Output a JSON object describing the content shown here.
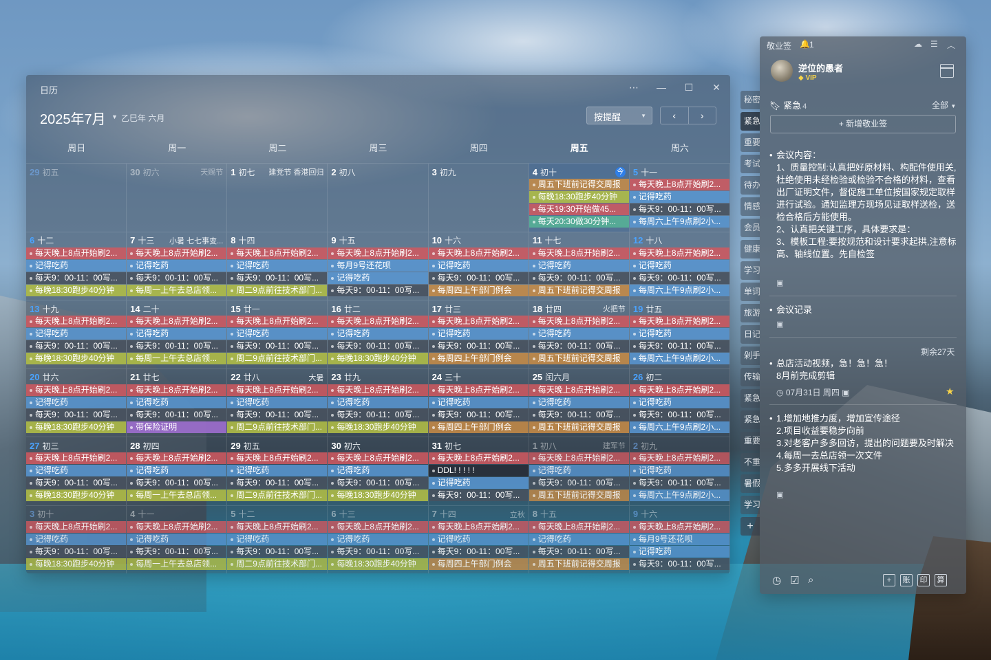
{
  "calendar": {
    "window_title": "日历",
    "controls": {
      "more": "⋯",
      "minimize": "—",
      "maximize": "☐",
      "close": "✕"
    },
    "month_title": "2025年7月",
    "lunar_year": "乙巳年 六月",
    "view_mode": "按提醒",
    "nav_prev": "‹",
    "nav_next": "›",
    "weekdays": [
      "周日",
      "周一",
      "周二",
      "周三",
      "周四",
      "周五",
      "周六"
    ],
    "today_badge": "今",
    "weeks": [
      [
        {
          "d": "29",
          "l": "初五",
          "f": "",
          "faded": true,
          "wk": true,
          "ev": []
        },
        {
          "d": "30",
          "l": "初六",
          "f": "天赐节",
          "faded": true,
          "ev": []
        },
        {
          "d": "1",
          "l": "初七",
          "f": "建党节 香港回归",
          "ev": []
        },
        {
          "d": "2",
          "l": "初八",
          "f": "",
          "ev": []
        },
        {
          "d": "3",
          "l": "初九",
          "f": "",
          "ev": []
        },
        {
          "d": "4",
          "l": "初十",
          "f": "",
          "today": true,
          "ev": [
            {
              "t": "周五下班前记得交周报",
              "c": "orange"
            },
            {
              "t": "每晚18:30跑步40分钟",
              "c": "yellow"
            },
            {
              "t": "每天19:30开始做45...",
              "c": "red"
            },
            {
              "t": "每天20:30做30分钟...",
              "c": "teal"
            }
          ]
        },
        {
          "d": "5",
          "l": "十一",
          "f": "",
          "wk": true,
          "ev": [
            {
              "t": "每天晚上8点开始刷2...",
              "c": "red"
            },
            {
              "t": "记得吃药",
              "c": "blue"
            },
            {
              "t": "每天9：00-11：00写...",
              "c": "gray"
            },
            {
              "t": "每周六上午9点刷2小...",
              "c": "blue"
            }
          ]
        }
      ],
      [
        {
          "d": "6",
          "l": "十二",
          "f": "",
          "wk": true,
          "ev": [
            {
              "t": "每天晚上8点开始刷2...",
              "c": "red"
            },
            {
              "t": "记得吃药",
              "c": "blue"
            },
            {
              "t": "每天9：00-11：00写...",
              "c": "gray"
            },
            {
              "t": "每晚18:30跑步40分钟",
              "c": "yellow"
            }
          ]
        },
        {
          "d": "7",
          "l": "十三",
          "f": "小暑 七七事变...",
          "ev": [
            {
              "t": "每天晚上8点开始刷2...",
              "c": "red"
            },
            {
              "t": "记得吃药",
              "c": "blue"
            },
            {
              "t": "每天9：00-11：00写...",
              "c": "gray"
            },
            {
              "t": "每周一上午去总店领...",
              "c": "yellow"
            }
          ]
        },
        {
          "d": "8",
          "l": "十四",
          "f": "",
          "ev": [
            {
              "t": "每天晚上8点开始刷2...",
              "c": "red"
            },
            {
              "t": "记得吃药",
              "c": "blue"
            },
            {
              "t": "每天9：00-11：00写...",
              "c": "gray"
            },
            {
              "t": "周二9点前往技术部门...",
              "c": "yellow"
            }
          ]
        },
        {
          "d": "9",
          "l": "十五",
          "f": "",
          "ev": [
            {
              "t": "每天晚上8点开始刷2...",
              "c": "red"
            },
            {
              "t": "每月9号还花呗",
              "c": "blue"
            },
            {
              "t": "记得吃药",
              "c": "blue"
            },
            {
              "t": "每天9：00-11：00写...",
              "c": "gray"
            }
          ]
        },
        {
          "d": "10",
          "l": "十六",
          "f": "",
          "ev": [
            {
              "t": "每天晚上8点开始刷2...",
              "c": "red"
            },
            {
              "t": "记得吃药",
              "c": "blue"
            },
            {
              "t": "每天9：00-11：00写...",
              "c": "gray"
            },
            {
              "t": "每周四上午部门例会",
              "c": "orange"
            }
          ]
        },
        {
          "d": "11",
          "l": "十七",
          "f": "",
          "ev": [
            {
              "t": "每天晚上8点开始刷2...",
              "c": "red"
            },
            {
              "t": "记得吃药",
              "c": "blue"
            },
            {
              "t": "每天9：00-11：00写...",
              "c": "gray"
            },
            {
              "t": "周五下班前记得交周报",
              "c": "orange"
            }
          ]
        },
        {
          "d": "12",
          "l": "十八",
          "f": "",
          "wk": true,
          "ev": [
            {
              "t": "每天晚上8点开始刷2...",
              "c": "red"
            },
            {
              "t": "记得吃药",
              "c": "blue"
            },
            {
              "t": "每天9：00-11：00写...",
              "c": "gray"
            },
            {
              "t": "每周六上午9点刷2小...",
              "c": "blue"
            }
          ]
        }
      ],
      [
        {
          "d": "13",
          "l": "十九",
          "f": "",
          "wk": true,
          "ev": [
            {
              "t": "每天晚上8点开始刷2...",
              "c": "red"
            },
            {
              "t": "记得吃药",
              "c": "blue"
            },
            {
              "t": "每天9：00-11：00写...",
              "c": "gray"
            },
            {
              "t": "每晚18:30跑步40分钟",
              "c": "yellow"
            }
          ]
        },
        {
          "d": "14",
          "l": "二十",
          "f": "",
          "ev": [
            {
              "t": "每天晚上8点开始刷2...",
              "c": "red"
            },
            {
              "t": "记得吃药",
              "c": "blue"
            },
            {
              "t": "每天9：00-11：00写...",
              "c": "gray"
            },
            {
              "t": "每周一上午去总店领...",
              "c": "yellow"
            }
          ]
        },
        {
          "d": "15",
          "l": "廿一",
          "f": "",
          "ev": [
            {
              "t": "每天晚上8点开始刷2...",
              "c": "red"
            },
            {
              "t": "记得吃药",
              "c": "blue"
            },
            {
              "t": "每天9：00-11：00写...",
              "c": "gray"
            },
            {
              "t": "周二9点前往技术部门...",
              "c": "yellow"
            }
          ]
        },
        {
          "d": "16",
          "l": "廿二",
          "f": "",
          "ev": [
            {
              "t": "每天晚上8点开始刷2...",
              "c": "red"
            },
            {
              "t": "记得吃药",
              "c": "blue"
            },
            {
              "t": "每天9：00-11：00写...",
              "c": "gray"
            },
            {
              "t": "每晚18:30跑步40分钟",
              "c": "yellow"
            }
          ]
        },
        {
          "d": "17",
          "l": "廿三",
          "f": "",
          "ev": [
            {
              "t": "每天晚上8点开始刷2...",
              "c": "red"
            },
            {
              "t": "记得吃药",
              "c": "blue"
            },
            {
              "t": "每天9：00-11：00写...",
              "c": "gray"
            },
            {
              "t": "每周四上午部门例会",
              "c": "orange"
            }
          ]
        },
        {
          "d": "18",
          "l": "廿四",
          "f": "火把节",
          "ev": [
            {
              "t": "每天晚上8点开始刷2...",
              "c": "red"
            },
            {
              "t": "记得吃药",
              "c": "blue"
            },
            {
              "t": "每天9：00-11：00写...",
              "c": "gray"
            },
            {
              "t": "周五下班前记得交周报",
              "c": "orange"
            }
          ]
        },
        {
          "d": "19",
          "l": "廿五",
          "f": "",
          "wk": true,
          "ev": [
            {
              "t": "每天晚上8点开始刷2...",
              "c": "red"
            },
            {
              "t": "记得吃药",
              "c": "blue"
            },
            {
              "t": "每天9：00-11：00写...",
              "c": "gray"
            },
            {
              "t": "每周六上午9点刷2小...",
              "c": "blue"
            }
          ]
        }
      ],
      [
        {
          "d": "20",
          "l": "廿六",
          "f": "",
          "wk": true,
          "ev": [
            {
              "t": "每天晚上8点开始刷2...",
              "c": "red"
            },
            {
              "t": "记得吃药",
              "c": "blue"
            },
            {
              "t": "每天9：00-11：00写...",
              "c": "gray"
            },
            {
              "t": "每晚18:30跑步40分钟",
              "c": "yellow"
            }
          ]
        },
        {
          "d": "21",
          "l": "廿七",
          "f": "",
          "ev": [
            {
              "t": "每天晚上8点开始刷2...",
              "c": "red"
            },
            {
              "t": "记得吃药",
              "c": "blue"
            },
            {
              "t": "每天9：00-11：00写...",
              "c": "gray"
            },
            {
              "t": "带保险证明",
              "c": "purple"
            }
          ]
        },
        {
          "d": "22",
          "l": "廿八",
          "f": "大暑",
          "ev": [
            {
              "t": "每天晚上8点开始刷2...",
              "c": "red"
            },
            {
              "t": "记得吃药",
              "c": "blue"
            },
            {
              "t": "每天9：00-11：00写...",
              "c": "gray"
            },
            {
              "t": "周二9点前往技术部门...",
              "c": "yellow"
            }
          ]
        },
        {
          "d": "23",
          "l": "廿九",
          "f": "",
          "ev": [
            {
              "t": "每天晚上8点开始刷2...",
              "c": "red"
            },
            {
              "t": "记得吃药",
              "c": "blue"
            },
            {
              "t": "每天9：00-11：00写...",
              "c": "gray"
            },
            {
              "t": "每晚18:30跑步40分钟",
              "c": "yellow"
            }
          ]
        },
        {
          "d": "24",
          "l": "三十",
          "f": "",
          "ev": [
            {
              "t": "每天晚上8点开始刷2...",
              "c": "red"
            },
            {
              "t": "记得吃药",
              "c": "blue"
            },
            {
              "t": "每天9：00-11：00写...",
              "c": "gray"
            },
            {
              "t": "每周四上午部门例会",
              "c": "orange"
            }
          ]
        },
        {
          "d": "25",
          "l": "闰六月",
          "f": "",
          "ev": [
            {
              "t": "每天晚上8点开始刷2...",
              "c": "red"
            },
            {
              "t": "记得吃药",
              "c": "blue"
            },
            {
              "t": "每天9：00-11：00写...",
              "c": "gray"
            },
            {
              "t": "周五下班前记得交周报",
              "c": "orange"
            }
          ]
        },
        {
          "d": "26",
          "l": "初二",
          "f": "",
          "wk": true,
          "ev": [
            {
              "t": "每天晚上8点开始刷2...",
              "c": "red"
            },
            {
              "t": "记得吃药",
              "c": "blue"
            },
            {
              "t": "每天9：00-11：00写...",
              "c": "gray"
            },
            {
              "t": "每周六上午9点刷2小...",
              "c": "blue"
            }
          ]
        }
      ],
      [
        {
          "d": "27",
          "l": "初三",
          "f": "",
          "wk": true,
          "ev": [
            {
              "t": "每天晚上8点开始刷2...",
              "c": "red"
            },
            {
              "t": "记得吃药",
              "c": "blue"
            },
            {
              "t": "每天9：00-11：00写...",
              "c": "gray"
            },
            {
              "t": "每晚18:30跑步40分钟",
              "c": "yellow"
            }
          ]
        },
        {
          "d": "28",
          "l": "初四",
          "f": "",
          "ev": [
            {
              "t": "每天晚上8点开始刷2...",
              "c": "red"
            },
            {
              "t": "记得吃药",
              "c": "blue"
            },
            {
              "t": "每天9：00-11：00写...",
              "c": "gray"
            },
            {
              "t": "每周一上午去总店领...",
              "c": "yellow"
            }
          ]
        },
        {
          "d": "29",
          "l": "初五",
          "f": "",
          "ev": [
            {
              "t": "每天晚上8点开始刷2...",
              "c": "red"
            },
            {
              "t": "记得吃药",
              "c": "blue"
            },
            {
              "t": "每天9：00-11：00写...",
              "c": "gray"
            },
            {
              "t": "周二9点前往技术部门...",
              "c": "yellow"
            }
          ]
        },
        {
          "d": "30",
          "l": "初六",
          "f": "",
          "ev": [
            {
              "t": "每天晚上8点开始刷2...",
              "c": "red"
            },
            {
              "t": "记得吃药",
              "c": "blue"
            },
            {
              "t": "每天9：00-11：00写...",
              "c": "gray"
            },
            {
              "t": "每晚18:30跑步40分钟",
              "c": "yellow"
            }
          ]
        },
        {
          "d": "31",
          "l": "初七",
          "f": "",
          "ev": [
            {
              "t": "每天晚上8点开始刷2...",
              "c": "red"
            },
            {
              "t": "DDL! ! ! ! !",
              "c": "dark"
            },
            {
              "t": "记得吃药",
              "c": "blue"
            },
            {
              "t": "每天9：00-11：00写...",
              "c": "gray"
            }
          ]
        },
        {
          "d": "1",
          "l": "初八",
          "f": "建军节",
          "faded": true,
          "ev": [
            {
              "t": "每天晚上8点开始刷2...",
              "c": "red"
            },
            {
              "t": "记得吃药",
              "c": "blue"
            },
            {
              "t": "每天9：00-11：00写...",
              "c": "gray"
            },
            {
              "t": "周五下班前记得交周报",
              "c": "orange"
            }
          ]
        },
        {
          "d": "2",
          "l": "初九",
          "f": "",
          "faded": true,
          "wk": true,
          "ev": [
            {
              "t": "每天晚上8点开始刷2...",
              "c": "red"
            },
            {
              "t": "记得吃药",
              "c": "blue"
            },
            {
              "t": "每天9：00-11：00写...",
              "c": "gray"
            },
            {
              "t": "每周六上午9点刷2小...",
              "c": "blue"
            }
          ]
        }
      ],
      [
        {
          "d": "3",
          "l": "初十",
          "f": "",
          "faded": true,
          "wk": true,
          "ev": [
            {
              "t": "每天晚上8点开始刷2...",
              "c": "red"
            },
            {
              "t": "记得吃药",
              "c": "blue"
            },
            {
              "t": "每天9：00-11：00写...",
              "c": "gray"
            },
            {
              "t": "每晚18:30跑步40分钟",
              "c": "yellow"
            }
          ]
        },
        {
          "d": "4",
          "l": "十一",
          "f": "",
          "faded": true,
          "ev": [
            {
              "t": "每天晚上8点开始刷2...",
              "c": "red"
            },
            {
              "t": "记得吃药",
              "c": "blue"
            },
            {
              "t": "每天9：00-11：00写...",
              "c": "gray"
            },
            {
              "t": "每周一上午去总店领...",
              "c": "yellow"
            }
          ]
        },
        {
          "d": "5",
          "l": "十二",
          "f": "",
          "faded": true,
          "ev": [
            {
              "t": "每天晚上8点开始刷2...",
              "c": "red"
            },
            {
              "t": "记得吃药",
              "c": "blue"
            },
            {
              "t": "每天9：00-11：00写...",
              "c": "gray"
            },
            {
              "t": "周二9点前往技术部门...",
              "c": "yellow"
            }
          ]
        },
        {
          "d": "6",
          "l": "十三",
          "f": "",
          "faded": true,
          "ev": [
            {
              "t": "每天晚上8点开始刷2...",
              "c": "red"
            },
            {
              "t": "记得吃药",
              "c": "blue"
            },
            {
              "t": "每天9：00-11：00写...",
              "c": "gray"
            },
            {
              "t": "每晚18:30跑步40分钟",
              "c": "yellow"
            }
          ]
        },
        {
          "d": "7",
          "l": "十四",
          "f": "立秋",
          "faded": true,
          "ev": [
            {
              "t": "每天晚上8点开始刷2...",
              "c": "red"
            },
            {
              "t": "记得吃药",
              "c": "blue"
            },
            {
              "t": "每天9：00-11：00写...",
              "c": "gray"
            },
            {
              "t": "每周四上午部门例会",
              "c": "orange"
            }
          ]
        },
        {
          "d": "8",
          "l": "十五",
          "f": "",
          "faded": true,
          "ev": [
            {
              "t": "每天晚上8点开始刷2...",
              "c": "red"
            },
            {
              "t": "记得吃药",
              "c": "blue"
            },
            {
              "t": "每天9：00-11：00写...",
              "c": "gray"
            },
            {
              "t": "周五下班前记得交周报",
              "c": "orange"
            }
          ]
        },
        {
          "d": "9",
          "l": "十六",
          "f": "",
          "faded": true,
          "wk": true,
          "ev": [
            {
              "t": "每天晚上8点开始刷2...",
              "c": "red"
            },
            {
              "t": "每月9号还花呗",
              "c": "blue"
            },
            {
              "t": "记得吃药",
              "c": "blue"
            },
            {
              "t": "每天9：00-11：00写...",
              "c": "gray"
            }
          ]
        }
      ]
    ]
  },
  "sidetabs": [
    "秘密",
    "紧急",
    "重要",
    "考试",
    "待办",
    "情感",
    "会员",
    "健康",
    "学习",
    "单词",
    "旅游",
    "日记",
    "剁手",
    "传输",
    "紧急",
    "紧急",
    "重要",
    "不重",
    "暑假",
    "学习"
  ],
  "sidetab_add": "+",
  "notes": {
    "app_title": "敬业签",
    "bell_icon": "bell-icon",
    "bell_count": "1",
    "user_name": "逆位的愚者",
    "vip_label": "VIP",
    "section": "紧急",
    "section_count": "4",
    "filter": "全部",
    "new_note": "+ 新增敬业签",
    "items": [
      {
        "body": "会议内容：\n1、质量控制:认真把好原材料、构配件使用关,杜绝使用未经检验或检验不合格的材料，查看出厂证明文件，督促施工单位按国家规定取样进行试验。通知监理方现场见证取样送检，送检合格后方能使用。\n2、认真把关键工序，具体要求是：\n3、模板工程:要按规范和设计要求起拱,注意标高、轴线位置。先自检签"
      },
      {
        "body": "会议记录"
      },
      {
        "body": "总店活动视频，急！急！急！\n8月前完成剪辑",
        "remain": "剩余27天",
        "meta": "07月31日 周四"
      },
      {
        "body": "1.增加地推力度，增加宣传途径\n2.项目收益要稳步向前\n3.对老客户多多回访，提出的问题要及时解决\n4.每周一去总店领一次文件\n5.多多开展线下活动"
      }
    ],
    "footer_box_labels": [
      "+",
      "账",
      "印",
      "算"
    ]
  }
}
